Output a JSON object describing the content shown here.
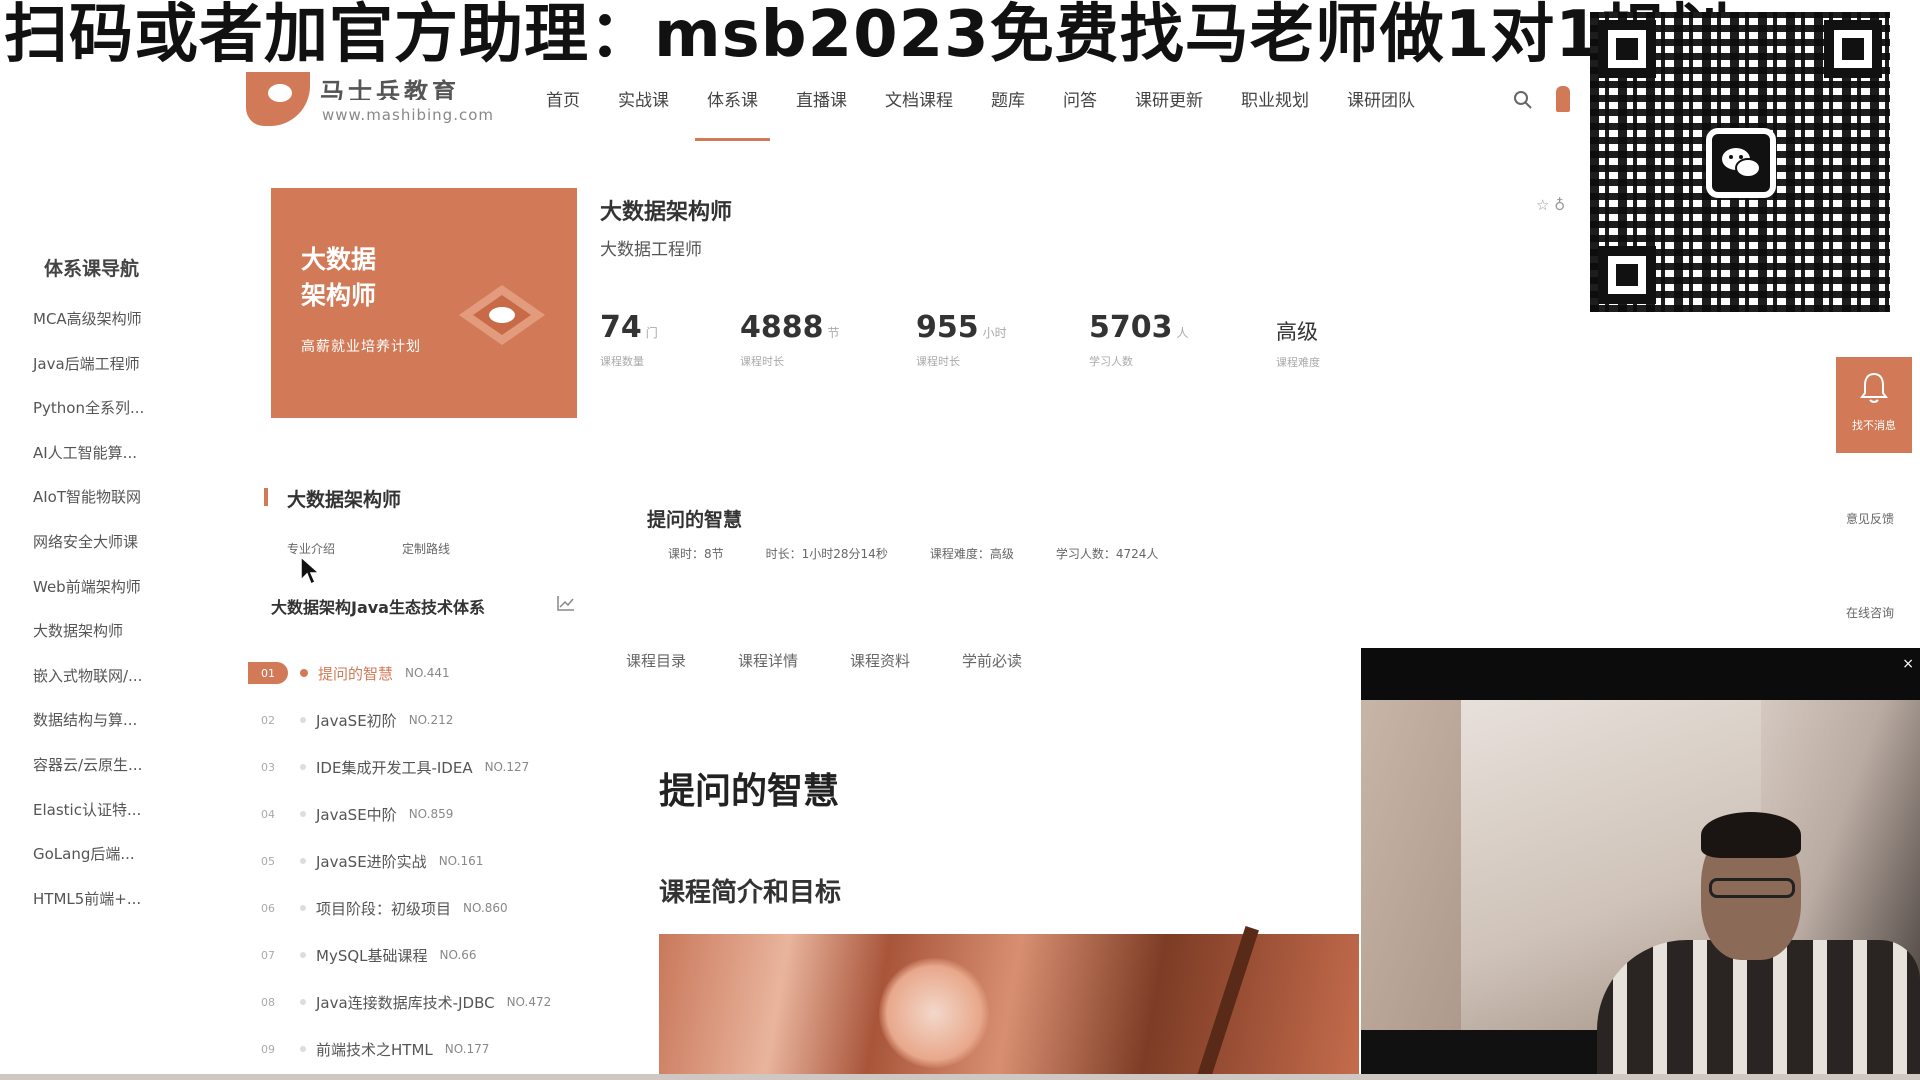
{
  "overlay": {
    "banner_text": "扫码或者加官方助理：msb2023免费找马老师做1对1规划"
  },
  "header": {
    "logo_cn": "马士兵教育",
    "logo_url": "www.mashibing.com",
    "nav": [
      "首页",
      "实战课",
      "体系课",
      "直播课",
      "文档课程",
      "题库",
      "问答",
      "课研更新",
      "职业规划",
      "课研团队"
    ],
    "active_nav": "体系课"
  },
  "sidebar": {
    "title": "体系课导航",
    "items": [
      "MCA高级架构师",
      "Java后端工程师",
      "Python全系列...",
      "AI人工智能算...",
      "AIoT智能物联网",
      "网络安全大师课",
      "Web前端架构师",
      "大数据架构师",
      "嵌入式物联网/...",
      "数据结构与算...",
      "容器云/云原生...",
      "Elastic认证特...",
      "GoLang后端...",
      "HTML5前端+..."
    ]
  },
  "course": {
    "cover_line1": "大数据",
    "cover_line2": "架构师",
    "cover_sub": "高薪就业培养计划",
    "title": "大数据架构师",
    "subtitle": "大数据工程师",
    "stats": [
      {
        "num": "74",
        "unit": "门",
        "label": "课程数量"
      },
      {
        "num": "4888",
        "unit": "节",
        "label": "课程时长"
      },
      {
        "num": "955",
        "unit": "小时",
        "label": "课程时长"
      },
      {
        "num": "5703",
        "unit": "人",
        "label": "学习人数"
      },
      {
        "num": "高级",
        "unit": "",
        "label": "课程难度"
      }
    ]
  },
  "float_panel": {
    "notify": "找不消息",
    "feedback": "意见反馈",
    "consult": "在线咨询"
  },
  "path": {
    "title": "大数据架构师",
    "tab1": "专业介绍",
    "tab2": "定制路线",
    "system_title": "大数据架构Java生态技术体系",
    "lessons": [
      {
        "idx": "01",
        "name": "提问的智慧",
        "no": "NO.441",
        "active": true
      },
      {
        "idx": "02",
        "name": "JavaSE初阶",
        "no": "NO.212"
      },
      {
        "idx": "03",
        "name": "IDE集成开发工具-IDEA",
        "no": "NO.127"
      },
      {
        "idx": "04",
        "name": "JavaSE中阶",
        "no": "NO.859"
      },
      {
        "idx": "05",
        "name": "JavaSE进阶实战",
        "no": "NO.161"
      },
      {
        "idx": "06",
        "name": "项目阶段：初级项目",
        "no": "NO.860"
      },
      {
        "idx": "07",
        "name": "MySQL基础课程",
        "no": "NO.66"
      },
      {
        "idx": "08",
        "name": "Java连接数据库技术-JDBC",
        "no": "NO.472"
      },
      {
        "idx": "09",
        "name": "前端技术之HTML",
        "no": "NO.177"
      }
    ]
  },
  "detail": {
    "title": "提问的智慧",
    "meta": [
      "课时：8节",
      "时长：1小时28分14秒",
      "课程难度：高级",
      "学习人数：4724人"
    ],
    "tabs": [
      "课程目录",
      "课程详情",
      "课程资料",
      "学前必读"
    ],
    "big_title": "提问的智慧",
    "intro_title": "课程简介和目标"
  },
  "webcam": {
    "close": "×"
  },
  "colors": {
    "accent": "#d27a57"
  }
}
